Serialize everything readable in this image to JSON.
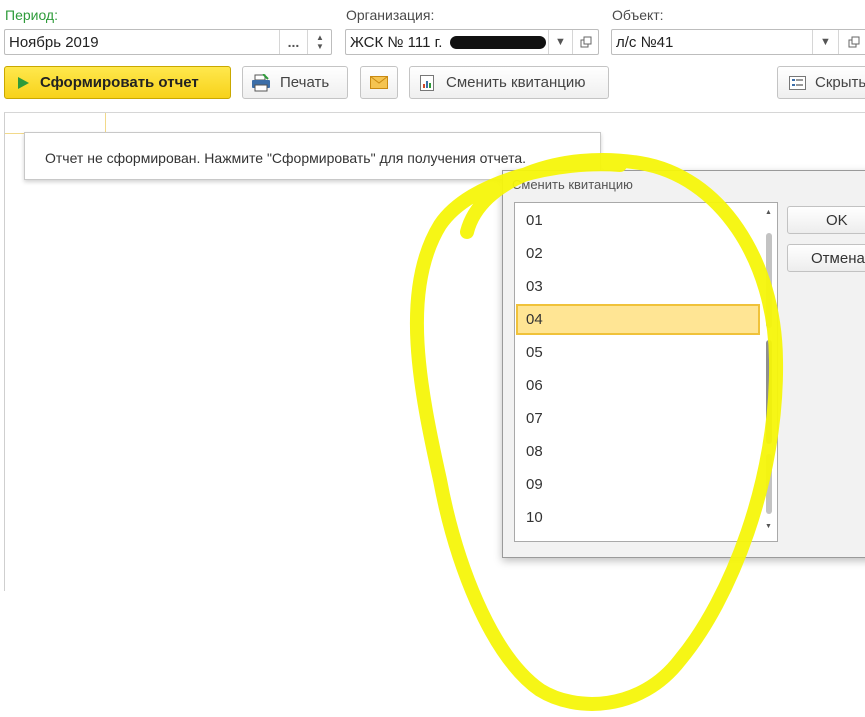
{
  "period": {
    "label": "Период:",
    "value": "Ноябрь 2019",
    "select_button": "..."
  },
  "organization": {
    "label": "Организация:",
    "value": "ЖСК № 111 г."
  },
  "object": {
    "label": "Объект:",
    "value": "л/с №41"
  },
  "toolbar": {
    "generate_label": "Сформировать отчет",
    "print_label": "Печать",
    "change_receipt_label": "Сменить квитанцию",
    "hide_label": "Скрыть"
  },
  "report": {
    "message": "Отчет не сформирован. Нажмите \"Сформировать\" для получения отчета."
  },
  "dialog": {
    "title": "Сменить квитанцию",
    "items": [
      "01",
      "02",
      "03",
      "04",
      "05",
      "06",
      "07",
      "08",
      "09",
      "10"
    ],
    "selected": "04",
    "ok_label": "OK",
    "cancel_label": "Отмена"
  },
  "colors": {
    "primary_button": "#f7d21a",
    "selection": "#ffe594",
    "annotation": "#f5f50a",
    "period_label": "#2e9b3a"
  }
}
